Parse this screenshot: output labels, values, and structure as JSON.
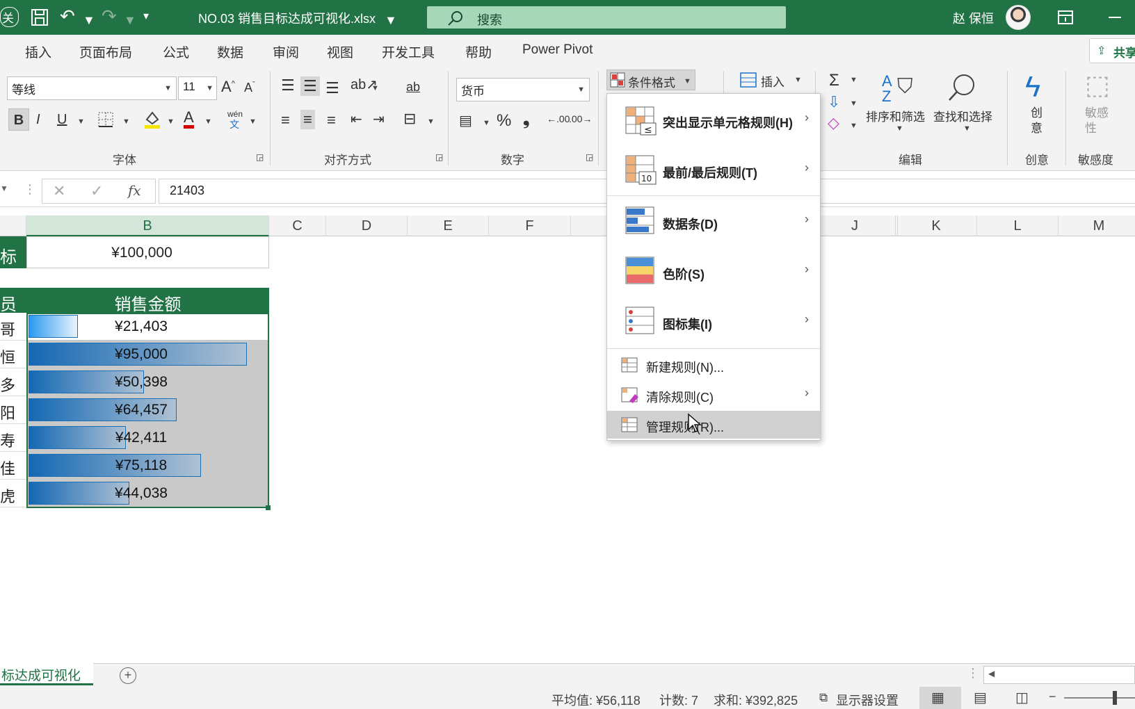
{
  "titlebar": {
    "filename": "NO.03 销售目标达成可视化.xlsx",
    "search_placeholder": "搜索",
    "user_name": "赵 保恒",
    "colors": {
      "background": "#217346",
      "search_bg": "#a7d6b8"
    }
  },
  "ribbon_tabs": [
    "插入",
    "页面布局",
    "公式",
    "数据",
    "审阅",
    "视图",
    "开发工具",
    "帮助",
    "Power Pivot"
  ],
  "share_label": "共享",
  "ribbon": {
    "font_group": {
      "font_name": "等线",
      "font_size": "11",
      "label": "字体",
      "bold": "B",
      "italic": "I",
      "underline": "U",
      "phonetic": "wén"
    },
    "align_group": {
      "label": "对齐方式",
      "wrap_icon": "ab"
    },
    "number_group": {
      "format": "货币",
      "label": "数字",
      "percent": "%",
      "comma": "❟",
      "dec_inc": ".00",
      "dec_dec": ".00"
    },
    "styles_group": {
      "cond_format": "条件格式"
    },
    "cells_group": {
      "insert": "插入"
    },
    "edit_group": {
      "label": "编辑",
      "sort_filter": "排序和筛选",
      "find_select": "查找和选择"
    },
    "ideas_group": {
      "label": "创意",
      "ideas": "创\n意"
    },
    "sensitivity_group": {
      "label": "敏感度",
      "sensitivity": "敏感\n性"
    }
  },
  "formula_bar": {
    "value": "21403",
    "fx": "fx"
  },
  "columns": [
    "B",
    "C",
    "D",
    "E",
    "F",
    "J",
    "K",
    "L",
    "M"
  ],
  "grid": {
    "row1": {
      "left_label": "标",
      "target": "¥100,000"
    },
    "header": {
      "left_label": "员",
      "title": "销售金额"
    },
    "rows": [
      {
        "left": "哥",
        "value": "¥21,403",
        "ratio": 0.21403
      },
      {
        "left": "恒",
        "value": "¥95,000",
        "ratio": 0.95
      },
      {
        "left": "多",
        "value": "¥50,398",
        "ratio": 0.50398
      },
      {
        "left": "阳",
        "value": "¥64,457",
        "ratio": 0.64457
      },
      {
        "left": "寿",
        "value": "¥42,411",
        "ratio": 0.42411
      },
      {
        "left": "佳",
        "value": "¥75,118",
        "ratio": 0.75118
      },
      {
        "left": "虎",
        "value": "¥44,038",
        "ratio": 0.44038
      }
    ]
  },
  "cf_menu": {
    "items": [
      {
        "label": "突出显示单元格规则(H)",
        "submenu": true,
        "icon": "highlight-cells-icon"
      },
      {
        "label": "最前/最后规则(T)",
        "submenu": true,
        "icon": "top-bottom-icon"
      },
      {
        "label": "数据条(D)",
        "submenu": true,
        "icon": "data-bars-icon"
      },
      {
        "label": "色阶(S)",
        "submenu": true,
        "icon": "color-scales-icon"
      },
      {
        "label": "图标集(I)",
        "submenu": true,
        "icon": "icon-sets-icon"
      }
    ],
    "small_items": [
      {
        "label": "新建规则(N)...",
        "submenu": false
      },
      {
        "label": "清除规则(C)",
        "submenu": true
      },
      {
        "label": "管理规则(R)...",
        "submenu": false,
        "highlighted": true
      }
    ]
  },
  "sheet_tab": "标达成可视化",
  "status": {
    "average": "平均值: ¥56,118",
    "count": "计数: 7",
    "sum": "求和: ¥392,825",
    "display_settings": "显示器设置"
  }
}
